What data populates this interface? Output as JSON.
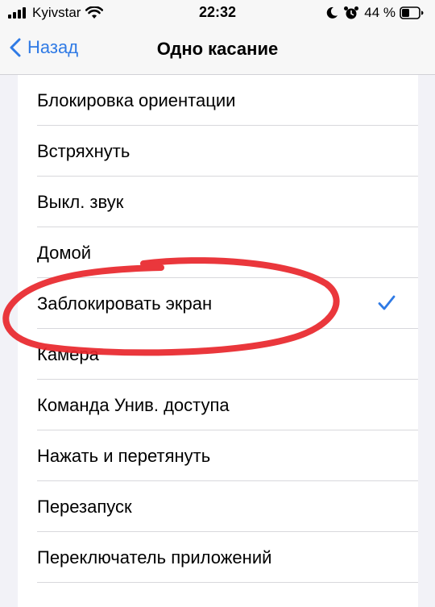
{
  "status_bar": {
    "carrier": "Kyivstar",
    "time": "22:32",
    "battery": "44 %"
  },
  "nav": {
    "back_label": "Назад",
    "title": "Одно касание"
  },
  "items": [
    {
      "label": "Блокировка ориентации",
      "selected": false
    },
    {
      "label": "Встряхнуть",
      "selected": false
    },
    {
      "label": "Выкл. звук",
      "selected": false
    },
    {
      "label": "Домой",
      "selected": false
    },
    {
      "label": "Заблокировать экран",
      "selected": true
    },
    {
      "label": "Камера",
      "selected": false
    },
    {
      "label": "Команда Унив. доступа",
      "selected": false
    },
    {
      "label": "Нажать и перетянуть",
      "selected": false
    },
    {
      "label": "Перезапуск",
      "selected": false
    },
    {
      "label": "Переключатель приложений",
      "selected": false
    }
  ],
  "colors": {
    "accent": "#2f7ae5",
    "annotation": "#e8262b"
  }
}
